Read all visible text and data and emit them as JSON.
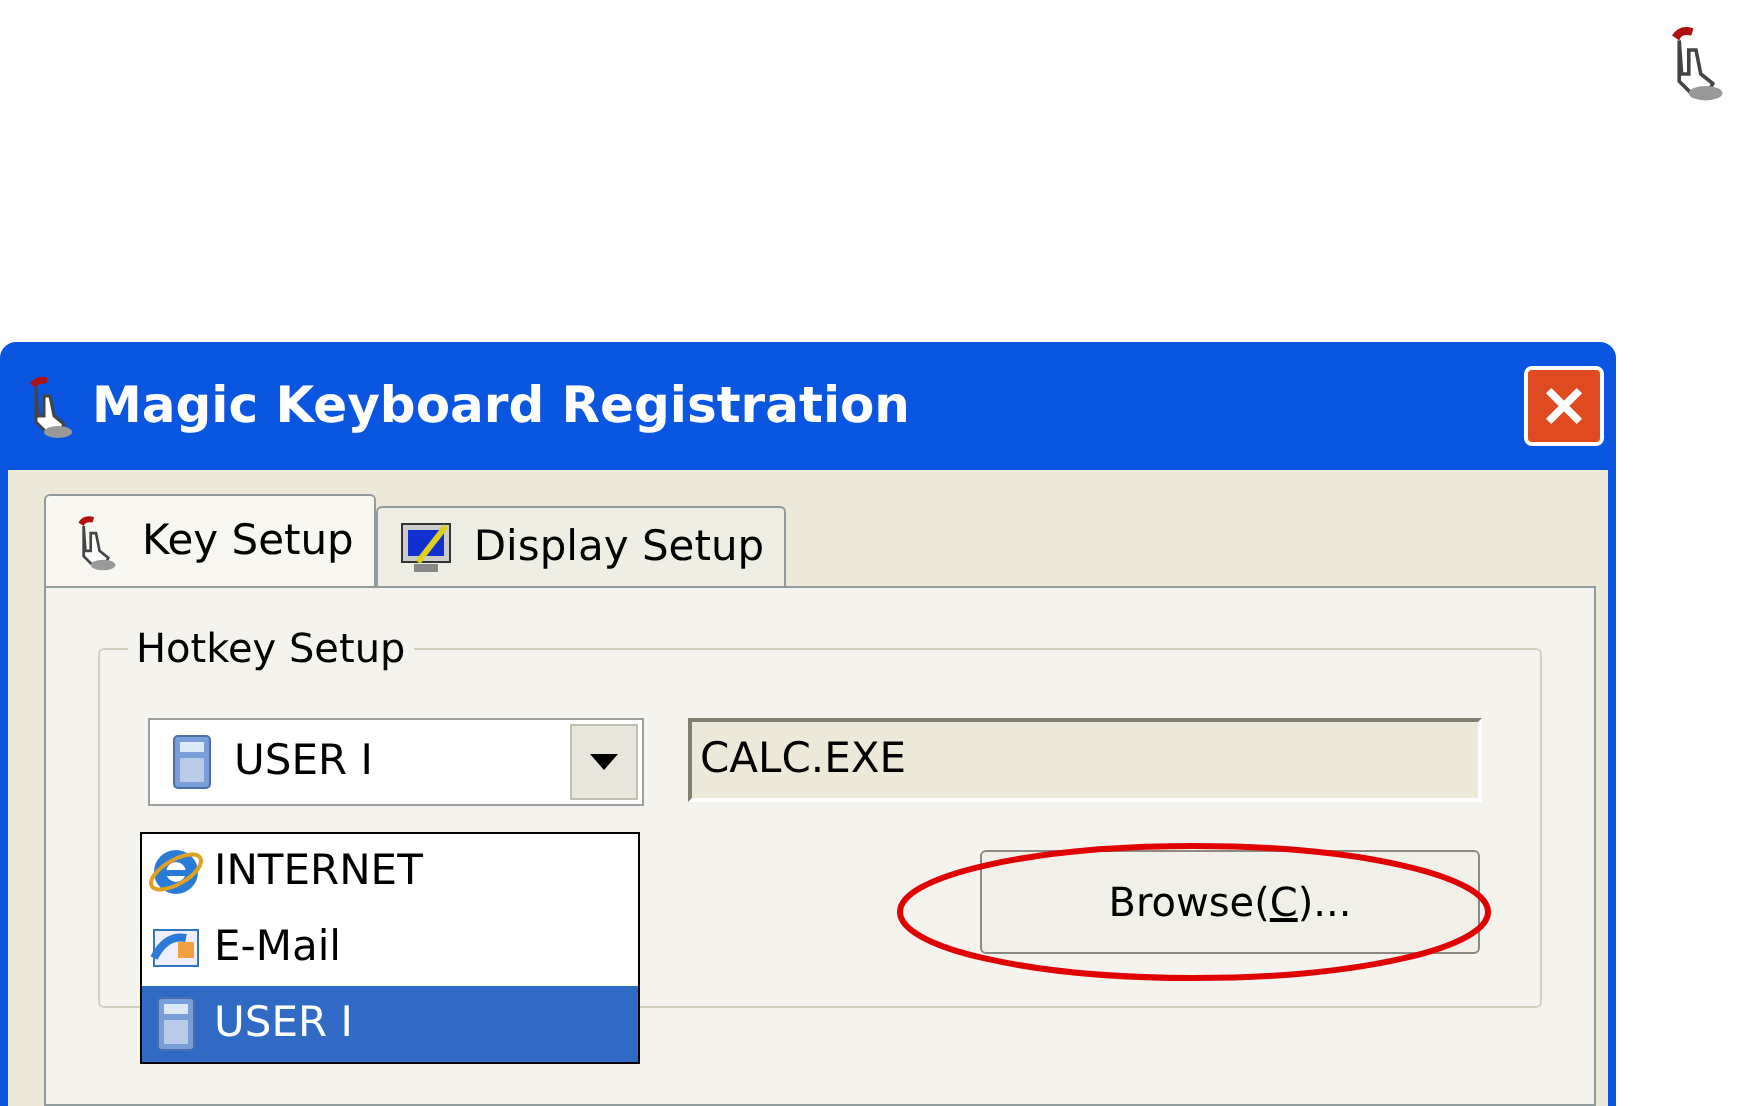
{
  "window": {
    "title": "Magic Keyboard Registration"
  },
  "tabs": [
    {
      "label": "Key Setup",
      "kind": "hand",
      "selected": true
    },
    {
      "label": "Display Setup",
      "kind": "monitor",
      "selected": false
    }
  ],
  "group": {
    "title": "Hotkey Setup"
  },
  "combo": {
    "value": "USER I",
    "kind": "calculator"
  },
  "dropdown_items": [
    {
      "label": "INTERNET",
      "kind": "browser",
      "selected": false
    },
    {
      "label": "E-Mail",
      "kind": "mail",
      "selected": false
    },
    {
      "label": "USER I",
      "kind": "calculator",
      "selected": true
    }
  ],
  "path_field": {
    "value": "CALC.EXE"
  },
  "browse_button": {
    "label_parts": [
      "Browse(",
      "C",
      ")..."
    ]
  }
}
